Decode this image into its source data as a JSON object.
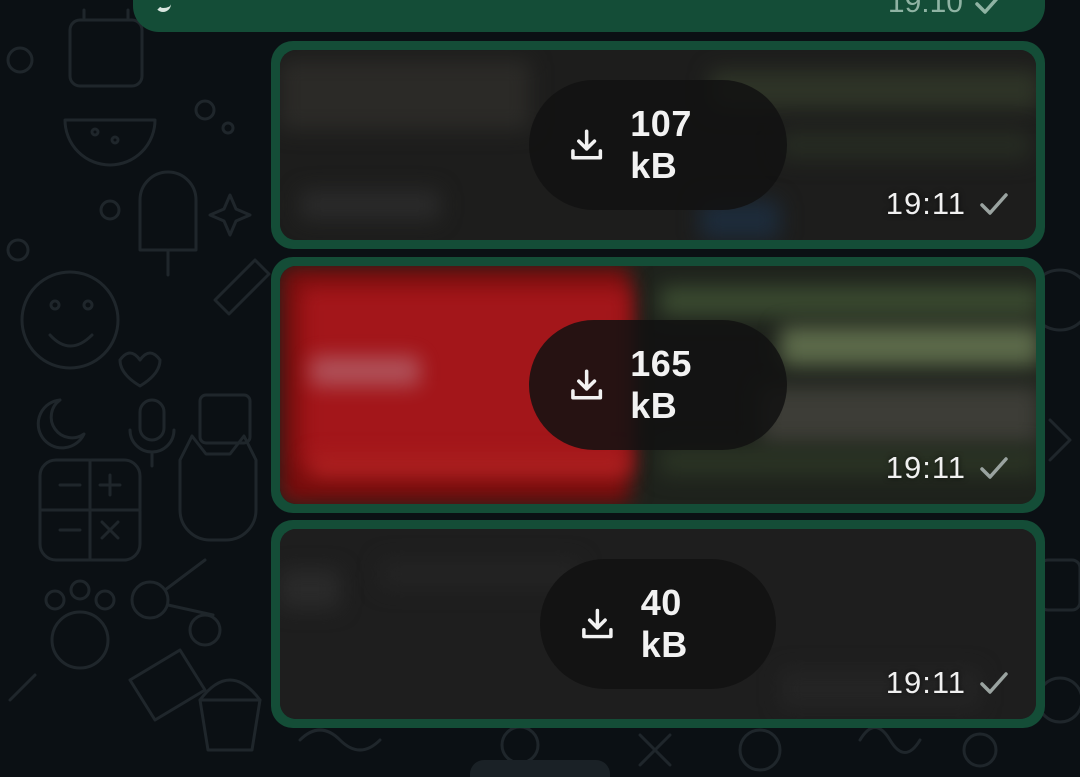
{
  "chat": {
    "previous_message": {
      "time": "19:10",
      "status": "sent"
    },
    "messages": [
      {
        "type": "image",
        "size": "107 kB",
        "time": "19:11",
        "status": "sent",
        "preview": "blurred dark"
      },
      {
        "type": "image",
        "size": "165 kB",
        "time": "19:11",
        "status": "sent",
        "preview": "blurred red and green"
      },
      {
        "type": "image",
        "size": "40 kB",
        "time": "19:11",
        "status": "sent",
        "preview": "blurred dark"
      }
    ]
  },
  "icons": {
    "download": "download-icon",
    "status": "check-icon"
  },
  "colors": {
    "background": "#0b1014",
    "outgoing_bubble": "#144d37",
    "download_pill": "#121212",
    "text": "#f2f2f2",
    "check": "#9aa3a0"
  }
}
